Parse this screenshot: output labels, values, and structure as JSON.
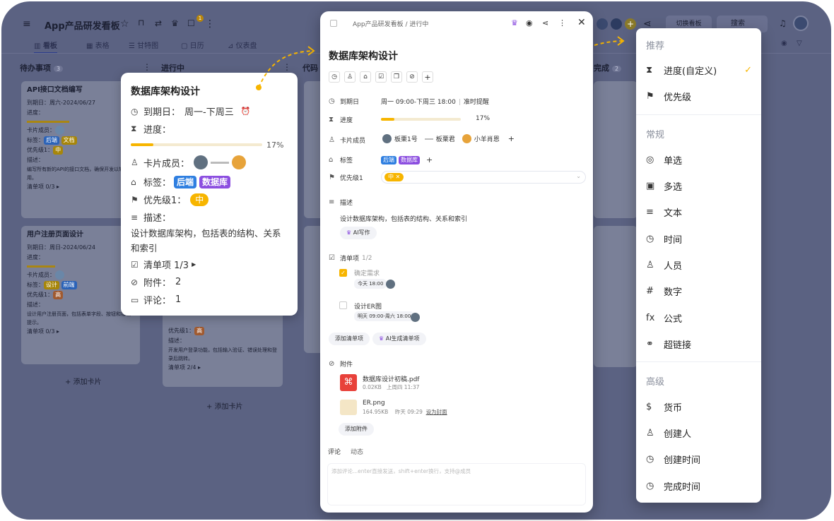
{
  "topbar": {
    "title": "App产品研发看板",
    "badge_count": "1",
    "switch_label": "切换看板",
    "search_placeholder": "搜索"
  },
  "tabs": [
    {
      "label": "看板"
    },
    {
      "label": "表格"
    },
    {
      "label": "甘特图"
    },
    {
      "label": "日历"
    },
    {
      "label": "仪表盘"
    }
  ],
  "columns": [
    {
      "name": "待办事项",
      "count": "3"
    },
    {
      "name": "进行中",
      "count": ""
    },
    {
      "name": "代码"
    },
    {
      "name": "完成",
      "count": "2"
    }
  ],
  "bg_cards": {
    "c1": {
      "title": "API接口文档编写",
      "due": "到期日：周六-2024/06/27",
      "progress": "进度：",
      "members": "卡片成员：",
      "tags_label": "标签：",
      "tag1": "后端",
      "tag2": "文档",
      "prio_label": "优先级1：",
      "prio": "中",
      "desc_label": "描述：",
      "desc": "编写所有新的API的接口文档，确保开发以轻松使用。",
      "check": "清单项 0/3 ▸"
    },
    "c2": {
      "title": "用户注册页面设计",
      "due": "到期日：周日-2024/06/24",
      "progress": "进度：",
      "members": "卡片成员：",
      "tags_label": "标签：",
      "tag1": "设计",
      "tag2": "前端",
      "prio_label": "优先级1：",
      "prio": "高",
      "desc_label": "描述：",
      "desc": "设计用户注册页面，包括表单字段、按钮和错误提示。",
      "check": "清单项 0/3 ▸"
    },
    "c3": {
      "prio_label": "优先级1：",
      "prio": "高",
      "desc_label": "描述：",
      "desc": "开发用户登录功能，包括输入验证、错误处理和登录后跳转。",
      "check": "清单项 2/4 ▸"
    },
    "add1": "+ 添加卡片",
    "add2": "+ 添加卡片"
  },
  "popup": {
    "title": "数据库架构设计",
    "due_label": "到期日：",
    "due_value": "周一-下周三",
    "progress_label": "进度：",
    "progress_value": "17%",
    "progress": 0.17,
    "members_label": "卡片成员：",
    "tags_label": "标签：",
    "tags": [
      "后端",
      "数据库"
    ],
    "prio_label": "优先级1：",
    "prio": "中",
    "desc_label": "描述：",
    "desc": "设计数据库架构，包括表的结构、关系和索引",
    "check": "清单项 1/3",
    "attach": "附件：",
    "attach_count": "2",
    "comment": "评论：",
    "comment_count": "1"
  },
  "detail": {
    "breadcrumb_board": "App产品研发看板",
    "breadcrumb_sep": "/",
    "breadcrumb_col": "进行中",
    "title": "数据库架构设计",
    "due_label": "到期日",
    "due_value": "周一 09:00-下周三 18:00",
    "due_remind": "准时提醒",
    "progress_label": "进度",
    "progress_value": "17%",
    "progress": 0.17,
    "members_label": "卡片成员",
    "members": [
      "板栗1号",
      "板栗君",
      "小羊肖恩"
    ],
    "tags_label": "标签",
    "tags": [
      "后端",
      "数据库"
    ],
    "prio_label": "优先级1",
    "prio": "中",
    "desc_label": "描述",
    "desc": "设计数据库架构，包括表的结构、关系和索引",
    "ai_write": "AI写作",
    "checklist_label": "清单项",
    "checklist_count": "1/2",
    "check1": "确定需求",
    "check1_time": "今天 18:00",
    "check2": "设计ER图",
    "check2_time": "明天 09:00-周六 18:00",
    "add_check": "添加清单项",
    "ai_check": "AI生成清单项",
    "attach_label": "附件",
    "file1": "数据库设计初稿.pdf",
    "file1_meta": "0.02KB",
    "file1_time": "上周四 11:37",
    "file2": "ER.png",
    "file2_meta": "164.95KB",
    "file2_time": "昨天 09:29",
    "file2_cover": "设为封面",
    "add_attach": "添加附件",
    "tab_comment": "评论",
    "tab_activity": "动态",
    "comment_placeholder": "添加评论...enter直接发送，shift+enter换行，支持@成员"
  },
  "menu": {
    "sec1": "推荐",
    "rec": [
      {
        "label": "进度(自定义)",
        "icon": "hourglass-icon"
      },
      {
        "label": "优先级",
        "icon": "flag-icon"
      }
    ],
    "sec2": "常规",
    "reg": [
      {
        "label": "单选"
      },
      {
        "label": "多选"
      },
      {
        "label": "文本"
      },
      {
        "label": "时间"
      },
      {
        "label": "人员"
      },
      {
        "label": "数字"
      },
      {
        "label": "公式"
      },
      {
        "label": "超链接"
      }
    ],
    "sec3": "高级",
    "adv": [
      {
        "label": "货币"
      },
      {
        "label": "创建人"
      },
      {
        "label": "创建时间"
      },
      {
        "label": "完成时间"
      }
    ]
  },
  "colors": {
    "overlay": "#5b6282",
    "accent": "#f7b500",
    "tag_backend": "#2f7fe0",
    "tag_db": "#8c4fe0",
    "check": "#f7b500"
  }
}
